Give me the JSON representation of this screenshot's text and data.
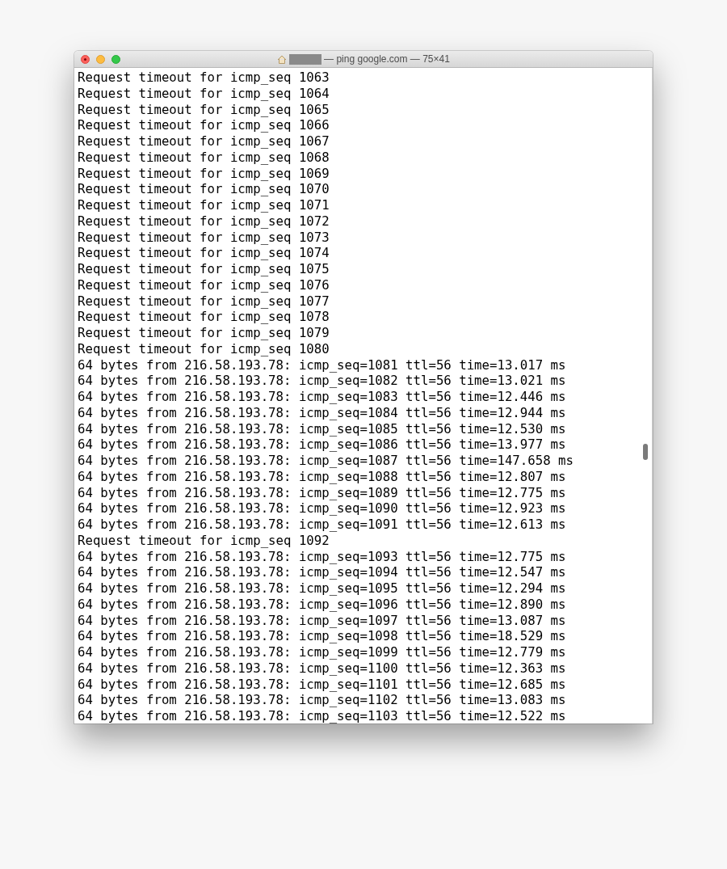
{
  "window": {
    "title": "— ping google.com — 75×41"
  },
  "lines": [
    "Request timeout for icmp_seq 1063",
    "Request timeout for icmp_seq 1064",
    "Request timeout for icmp_seq 1065",
    "Request timeout for icmp_seq 1066",
    "Request timeout for icmp_seq 1067",
    "Request timeout for icmp_seq 1068",
    "Request timeout for icmp_seq 1069",
    "Request timeout for icmp_seq 1070",
    "Request timeout for icmp_seq 1071",
    "Request timeout for icmp_seq 1072",
    "Request timeout for icmp_seq 1073",
    "Request timeout for icmp_seq 1074",
    "Request timeout for icmp_seq 1075",
    "Request timeout for icmp_seq 1076",
    "Request timeout for icmp_seq 1077",
    "Request timeout for icmp_seq 1078",
    "Request timeout for icmp_seq 1079",
    "Request timeout for icmp_seq 1080",
    "64 bytes from 216.58.193.78: icmp_seq=1081 ttl=56 time=13.017 ms",
    "64 bytes from 216.58.193.78: icmp_seq=1082 ttl=56 time=13.021 ms",
    "64 bytes from 216.58.193.78: icmp_seq=1083 ttl=56 time=12.446 ms",
    "64 bytes from 216.58.193.78: icmp_seq=1084 ttl=56 time=12.944 ms",
    "64 bytes from 216.58.193.78: icmp_seq=1085 ttl=56 time=12.530 ms",
    "64 bytes from 216.58.193.78: icmp_seq=1086 ttl=56 time=13.977 ms",
    "64 bytes from 216.58.193.78: icmp_seq=1087 ttl=56 time=147.658 ms",
    "64 bytes from 216.58.193.78: icmp_seq=1088 ttl=56 time=12.807 ms",
    "64 bytes from 216.58.193.78: icmp_seq=1089 ttl=56 time=12.775 ms",
    "64 bytes from 216.58.193.78: icmp_seq=1090 ttl=56 time=12.923 ms",
    "64 bytes from 216.58.193.78: icmp_seq=1091 ttl=56 time=12.613 ms",
    "Request timeout for icmp_seq 1092",
    "64 bytes from 216.58.193.78: icmp_seq=1093 ttl=56 time=12.775 ms",
    "64 bytes from 216.58.193.78: icmp_seq=1094 ttl=56 time=12.547 ms",
    "64 bytes from 216.58.193.78: icmp_seq=1095 ttl=56 time=12.294 ms",
    "64 bytes from 216.58.193.78: icmp_seq=1096 ttl=56 time=12.890 ms",
    "64 bytes from 216.58.193.78: icmp_seq=1097 ttl=56 time=13.087 ms",
    "64 bytes from 216.58.193.78: icmp_seq=1098 ttl=56 time=18.529 ms",
    "64 bytes from 216.58.193.78: icmp_seq=1099 ttl=56 time=12.779 ms",
    "64 bytes from 216.58.193.78: icmp_seq=1100 ttl=56 time=12.363 ms",
    "64 bytes from 216.58.193.78: icmp_seq=1101 ttl=56 time=12.685 ms",
    "64 bytes from 216.58.193.78: icmp_seq=1102 ttl=56 time=13.083 ms",
    "64 bytes from 216.58.193.78: icmp_seq=1103 ttl=56 time=12.522 ms"
  ]
}
